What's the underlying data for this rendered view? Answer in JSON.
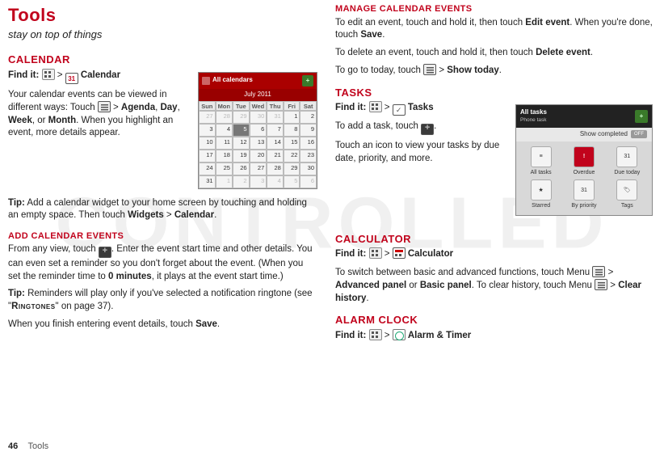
{
  "page": {
    "number": "46",
    "section": "Tools"
  },
  "title": "Tools",
  "subtitle": "stay on top of things",
  "calendar": {
    "heading": "Calendar",
    "findit_label": "Find it:",
    "findit_target": "Calendar",
    "p1a": "Your calendar events can be viewed in different ways: Touch ",
    "opt1": "Agenda",
    "opt2": "Day",
    "opt3": "Week",
    "opt4": "Month",
    "p1b": ". When you highlight an event, more details appear.",
    "tip1_label": "Tip:",
    "tip1_body": " Add a calendar widget to your home screen by touching and holding an empty space. Then touch ",
    "tip1_widgets": "Widgets",
    "tip1_cal": "Calendar",
    "widget": {
      "title": "All calendars",
      "month": "July 2011",
      "dow": [
        "Sun",
        "Mon",
        "Tue",
        "Wed",
        "Thu",
        "Fri",
        "Sat"
      ],
      "cells": [
        {
          "v": "27",
          "dim": true
        },
        {
          "v": "28",
          "dim": true
        },
        {
          "v": "29",
          "dim": true
        },
        {
          "v": "30",
          "dim": true
        },
        {
          "v": "31",
          "dim": true
        },
        {
          "v": "1"
        },
        {
          "v": "2"
        },
        {
          "v": "3"
        },
        {
          "v": "4"
        },
        {
          "v": "5",
          "sel": true
        },
        {
          "v": "6"
        },
        {
          "v": "7"
        },
        {
          "v": "8"
        },
        {
          "v": "9"
        },
        {
          "v": "10"
        },
        {
          "v": "11"
        },
        {
          "v": "12"
        },
        {
          "v": "13"
        },
        {
          "v": "14"
        },
        {
          "v": "15"
        },
        {
          "v": "16"
        },
        {
          "v": "17"
        },
        {
          "v": "18"
        },
        {
          "v": "19"
        },
        {
          "v": "20"
        },
        {
          "v": "21"
        },
        {
          "v": "22"
        },
        {
          "v": "23"
        },
        {
          "v": "24"
        },
        {
          "v": "25"
        },
        {
          "v": "26"
        },
        {
          "v": "27"
        },
        {
          "v": "28"
        },
        {
          "v": "29"
        },
        {
          "v": "30"
        },
        {
          "v": "31"
        },
        {
          "v": "1",
          "dim": true
        },
        {
          "v": "2",
          "dim": true
        },
        {
          "v": "3",
          "dim": true
        },
        {
          "v": "4",
          "dim": true
        },
        {
          "v": "5",
          "dim": true
        },
        {
          "v": "6",
          "dim": true
        }
      ]
    }
  },
  "add_events": {
    "heading": "Add calendar events",
    "p1a": "From any view, touch ",
    "p1b": ". Enter the event start time and other details. You can even set a reminder so you don't forget about the event. (When you set the reminder time to ",
    "zeromin": "0 minutes",
    "p1c": ", it plays at the event start time.)",
    "tip_label": "Tip:",
    "tip_body": " Reminders will play only if you've selected a notification ringtone (see \"",
    "ringtones": "Ringtones",
    "tip_after": "\" on page 37).",
    "p2a": "When you finish entering event details, touch ",
    "save": "Save"
  },
  "manage": {
    "heading": "Manage calendar events",
    "p1a": "To edit an event, touch and hold it, then touch ",
    "edit": "Edit event",
    "p1b": ". When you're done, touch ",
    "save": "Save",
    "p2a": "To delete an event, touch and hold it, then touch ",
    "delete": "Delete event",
    "p3a": "To go to today, touch ",
    "show_today": "Show today"
  },
  "tasks": {
    "heading": "Tasks",
    "findit_label": "Find it:",
    "findit_target": "Tasks",
    "p1a": "To add a task, touch ",
    "p2": "Touch an icon to view your tasks by due date, priority, and more.",
    "widget": {
      "title": "All tasks",
      "subtitle": "Phone task",
      "show_completed": "Show completed",
      "off": "OFF",
      "items": [
        "All tasks",
        "Overdue",
        "Due today",
        "Starred",
        "By priority",
        "Tags"
      ]
    }
  },
  "calculator": {
    "heading": "Calculator",
    "findit_label": "Find it:",
    "findit_target": "Calculator",
    "p1a": "To switch between basic and advanced functions, touch Menu ",
    "adv": "Advanced panel",
    "or": " or ",
    "basic": "Basic panel",
    "p1b": ". To clear history, touch Menu ",
    "clear": "Clear history"
  },
  "alarm": {
    "heading": "Alarm clock",
    "findit_label": "Find it:",
    "findit_target": "Alarm & Timer"
  }
}
